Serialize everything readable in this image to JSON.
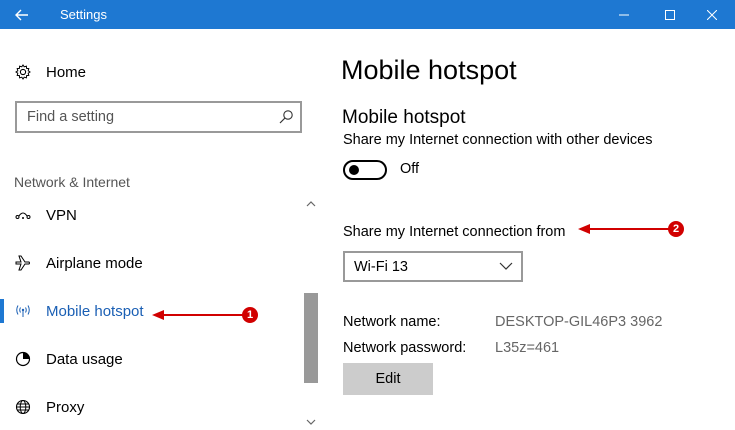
{
  "window": {
    "title": "Settings",
    "back_icon": "back-arrow-icon",
    "title_bar_color": "#1e78d2"
  },
  "sidebar": {
    "home_label": "Home",
    "search_placeholder": "Find a setting",
    "section_heading": "Network & Internet",
    "items": [
      {
        "label": "VPN",
        "icon": "vpn-icon"
      },
      {
        "label": "Airplane mode",
        "icon": "airplane-icon"
      },
      {
        "label": "Mobile hotspot",
        "icon": "hotspot-icon",
        "active": true
      },
      {
        "label": "Data usage",
        "icon": "data-usage-icon"
      },
      {
        "label": "Proxy",
        "icon": "globe-icon"
      }
    ]
  },
  "main": {
    "page_title": "Mobile hotspot",
    "section_title": "Mobile hotspot",
    "share_description": "Share my Internet connection with other devices",
    "toggle_state": "Off",
    "share_from_label": "Share my Internet connection from",
    "share_from_value": "Wi-Fi 13",
    "network_name_label": "Network name:",
    "network_name_value": "DESKTOP-GIL46P3 3962",
    "network_password_label": "Network password:",
    "network_password_value": "L35z=461",
    "edit_label": "Edit"
  },
  "annotations": {
    "badge_1": "1",
    "badge_2": "2",
    "color": "#d10000"
  }
}
